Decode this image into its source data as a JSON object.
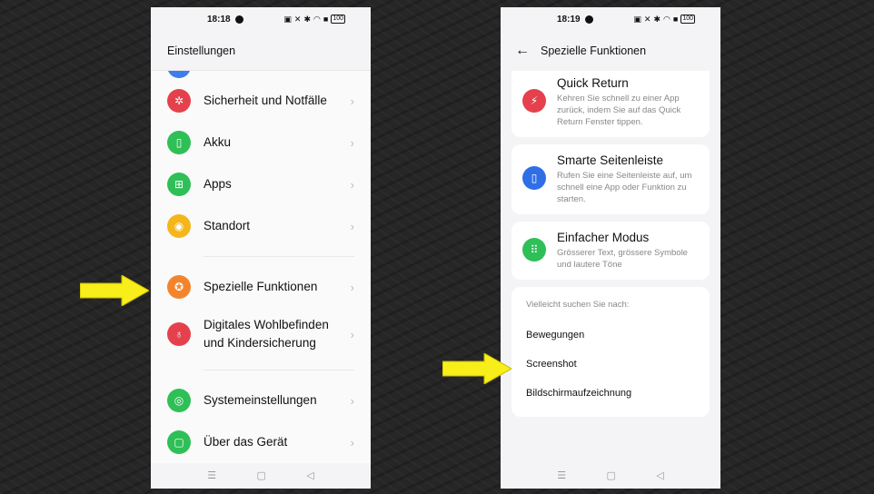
{
  "left_phone": {
    "status": {
      "time": "18:18",
      "battery": "100"
    },
    "title": "Einstellungen",
    "items": [
      {
        "label": "Sicherheit und Notfälle",
        "icon": "asterisk-icon",
        "color": "#e5414d"
      },
      {
        "label": "Akku",
        "icon": "battery-icon",
        "color": "#2fbf57"
      },
      {
        "label": "Apps",
        "icon": "apps-grid-icon",
        "color": "#2fbf57"
      },
      {
        "label": "Standort",
        "icon": "location-icon",
        "color": "#f4b61a"
      },
      {
        "label": "Spezielle Funktionen",
        "icon": "star-icon",
        "color": "#f4842b"
      },
      {
        "label_line1": "Digitales Wohlbefinden",
        "label_line2": "und Kindersicherung",
        "icon": "wellbeing-icon",
        "color": "#e5414d"
      },
      {
        "label": "Systemeinstellungen",
        "icon": "settings-icon",
        "color": "#2fbf57"
      },
      {
        "label": "Über das Gerät",
        "icon": "device-icon",
        "color": "#2fbf57"
      }
    ]
  },
  "right_phone": {
    "status": {
      "time": "18:19",
      "battery": "100"
    },
    "title": "Spezielle Funktionen",
    "cards": [
      {
        "title": "Quick Return",
        "desc": "Kehren Sie schnell zu einer App zurück, indem Sie auf das Quick Return Fenster tippen.",
        "icon": "quick-return-icon",
        "color": "#e5414d"
      },
      {
        "title": "Smarte Seitenleiste",
        "desc": "Rufen Sie eine Seitenleiste auf, um schnell eine App oder Funktion zu starten.",
        "icon": "sidebar-icon",
        "color": "#2f6fe6"
      },
      {
        "title": "Einfacher Modus",
        "desc": "Grösserer Text, grössere Symbole und lautere Töne",
        "icon": "simple-mode-icon",
        "color": "#2fbf57"
      }
    ],
    "suggest": {
      "caption": "Vielleicht suchen Sie nach:",
      "links": [
        "Bewegungen",
        "Screenshot",
        "Bildschirmaufzeichnung"
      ]
    }
  },
  "colors": {
    "arrow": "#f7ee1a"
  }
}
